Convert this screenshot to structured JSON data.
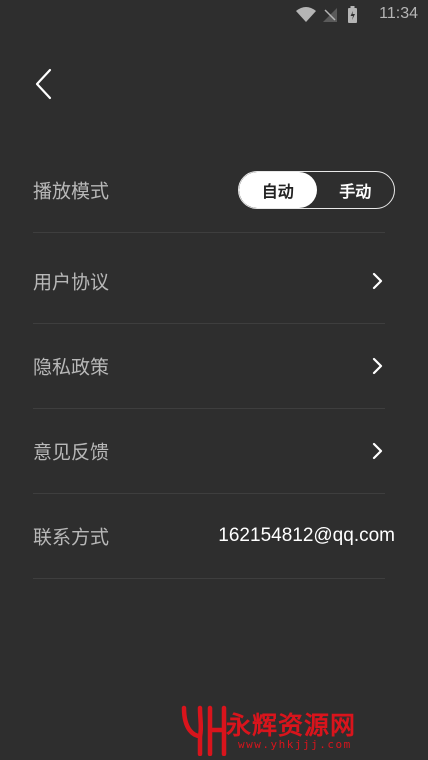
{
  "status_bar": {
    "time": "11:34"
  },
  "settings": {
    "play_mode": {
      "label": "播放模式",
      "options": [
        "自动",
        "手动"
      ],
      "selected": "自动"
    },
    "user_agreement": {
      "label": "用户协议"
    },
    "privacy_policy": {
      "label": "隐私政策"
    },
    "feedback": {
      "label": "意见反馈"
    },
    "contact": {
      "label": "联系方式",
      "value": "162154812@qq.com"
    }
  },
  "watermark": {
    "name": "永辉资源网",
    "url": "www.yhkjjj.com"
  },
  "colors": {
    "background": "#2e2e2e",
    "divider": "#3e3e3e",
    "watermark": "#d9141c"
  }
}
